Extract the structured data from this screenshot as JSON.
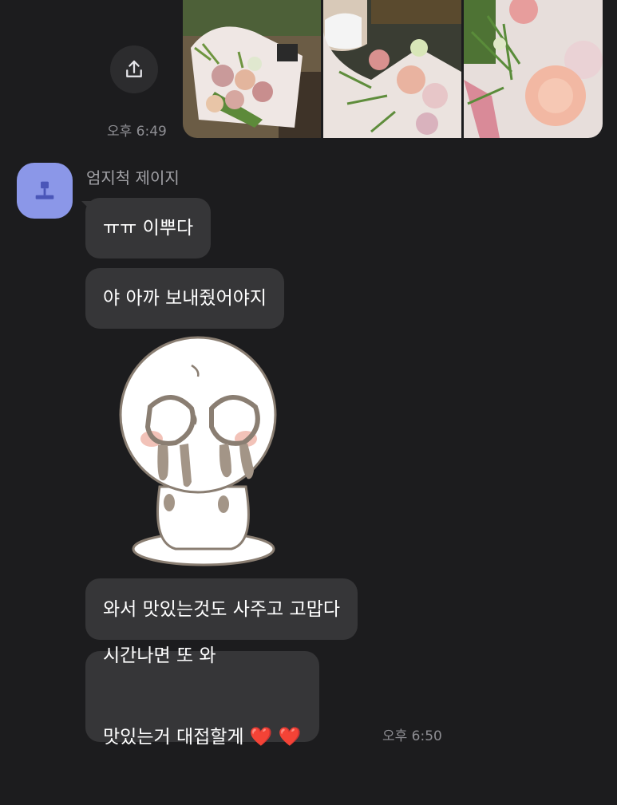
{
  "sent": {
    "time": "오후 6:49",
    "share_icon": "share-icon",
    "photos": [
      "flower-bouquet-photo",
      "selfie-with-bouquet-photo",
      "carnation-bouquet-photo"
    ]
  },
  "received": {
    "sender_name": "엄지척 제이지",
    "avatar_icon": "default-profile-icon",
    "messages": [
      {
        "text": "ㅠㅠ 이뿌다"
      },
      {
        "text": "야 아까 보내줬어야지"
      },
      {
        "text": "와서 맛있는것도 사주고 고맙다"
      },
      {
        "line1": "시간나면 또 와",
        "line2": "맛있는거 대접할게",
        "hearts": "❤️ ❤️"
      }
    ],
    "sticker": "crying-character-sticker",
    "time": "오후 6:50"
  },
  "colors": {
    "background": "#1c1c1e",
    "bubble": "#363638",
    "avatar": "#8b97e8",
    "timestamp": "#8e8e93"
  }
}
